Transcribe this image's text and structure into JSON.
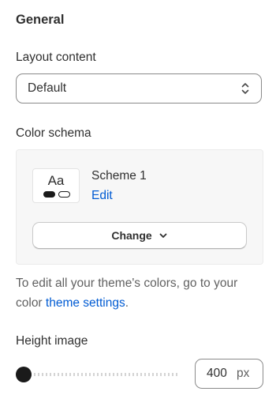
{
  "section": {
    "title": "General"
  },
  "layout_content": {
    "label": "Layout content",
    "selected": "Default"
  },
  "color_schema": {
    "label": "Color schema",
    "scheme_preview_text": "Aa",
    "scheme_name": "Scheme 1",
    "edit_label": "Edit",
    "change_label": "Change"
  },
  "help": {
    "text_before": "To edit all your theme's colors, go to your color ",
    "link": "theme settings",
    "text_after": "."
  },
  "height_image": {
    "label": "Height image",
    "value": "400",
    "unit": "px",
    "slider_fraction": 0.0
  },
  "colors": {
    "link": "#005bd3",
    "text": "#303030",
    "thumb": "#1a1a1a"
  }
}
